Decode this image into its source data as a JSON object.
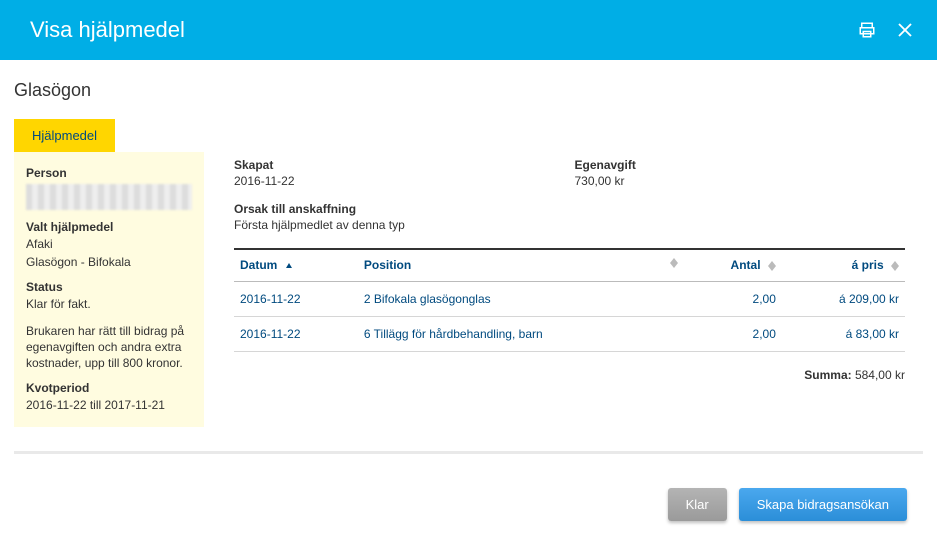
{
  "title": "Visa hjälpmedel",
  "page_title": "Glasögon",
  "tab": {
    "label": "Hjälpmedel"
  },
  "side": {
    "person_label": "Person",
    "valt_label": "Valt hjälpmedel",
    "valt_line1": "Afaki",
    "valt_line2": "Glasögon - Bifokala",
    "status_label": "Status",
    "status_value": "Klar för fakt.",
    "note": "Brukaren har rätt till bidrag på egenavgiften och andra extra kostnader, upp till 800 kronor.",
    "kvot_label": "Kvotperiod",
    "kvot_value": "2016-11-22 till 2017-11-21"
  },
  "meta": {
    "created_label": "Skapat",
    "created_value": "2016-11-22",
    "fee_label": "Egenavgift",
    "fee_value": "730,00 kr"
  },
  "reason": {
    "label": "Orsak till anskaffning",
    "value": "Första hjälpmedlet av denna typ"
  },
  "table": {
    "headers": {
      "date": "Datum",
      "position": "Position",
      "qty": "Antal",
      "price": "á pris"
    },
    "rows": [
      {
        "date": "2016-11-22",
        "position": "2 Bifokala glasögonglas",
        "qty": "2,00",
        "price": "á 209,00 kr"
      },
      {
        "date": "2016-11-22",
        "position": "6 Tillägg för hårdbehandling, barn",
        "qty": "2,00",
        "price": "á 83,00 kr"
      }
    ]
  },
  "summary": {
    "label": "Summa:",
    "value": "584,00 kr"
  },
  "buttons": {
    "klar": "Klar",
    "skapa": "Skapa bidragsansökan"
  }
}
